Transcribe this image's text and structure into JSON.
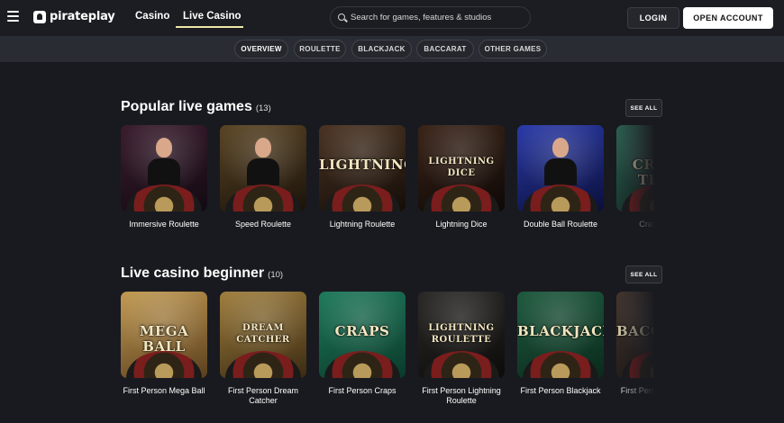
{
  "header": {
    "logo_text": "pirateplay",
    "nav": [
      {
        "label": "Casino"
      },
      {
        "label": "Live Casino",
        "active": true
      }
    ],
    "search_placeholder": "Search for games, features & studios",
    "login_label": "LOGIN",
    "open_account_label": "OPEN ACCOUNT",
    "accent_color": "#ede7a8"
  },
  "subnav": {
    "items": [
      {
        "label": "OVERVIEW",
        "active": true
      },
      {
        "label": "ROULETTE"
      },
      {
        "label": "BLACKJACK"
      },
      {
        "label": "BACCARAT"
      },
      {
        "label": "OTHER GAMES"
      }
    ]
  },
  "sections": [
    {
      "title": "Popular live games",
      "count": "(13)",
      "see_all_label": "SEE ALL",
      "games": [
        {
          "title": "Immersive Roulette",
          "art_text": "",
          "colors": [
            "#3a1c2e",
            "#120a12"
          ]
        },
        {
          "title": "Speed Roulette",
          "art_text": "",
          "colors": [
            "#5a4524",
            "#1a120a"
          ]
        },
        {
          "title": "Lightning Roulette",
          "art_text": "LIGHTNING",
          "colors": [
            "#4a3322",
            "#140d08"
          ]
        },
        {
          "title": "Lightning Dice",
          "art_text": "LIGHTNING DICE",
          "colors": [
            "#3a2418",
            "#0e0806"
          ]
        },
        {
          "title": "Double Ball Roulette",
          "art_text": "",
          "colors": [
            "#2a3aa8",
            "#0a0f3a"
          ]
        },
        {
          "title": "Crazy Time",
          "art_text": "CRAZY TIME",
          "colors": [
            "#2e6a58",
            "#0f2a22"
          ]
        }
      ]
    },
    {
      "title": "Live casino beginner",
      "count": "(10)",
      "see_all_label": "SEE ALL",
      "games": [
        {
          "title": "First Person Mega Ball",
          "art_text": "MEGA BALL",
          "colors": [
            "#c29a52",
            "#5a3f1e"
          ]
        },
        {
          "title": "First Person Dream Catcher",
          "art_text": "DREAM CATCHER",
          "colors": [
            "#a07f3e",
            "#3a2a12"
          ]
        },
        {
          "title": "First Person Craps",
          "art_text": "CRAPS",
          "colors": [
            "#1f7a5c",
            "#0a3a2a"
          ]
        },
        {
          "title": "First Person Lightning Roulette",
          "art_text": "LIGHTNING ROULETTE",
          "colors": [
            "#2b2a28",
            "#0c0b0a"
          ]
        },
        {
          "title": "First Person Blackjack",
          "art_text": "BLACKJACK",
          "colors": [
            "#1e5a3e",
            "#0a2a1c"
          ]
        },
        {
          "title": "First Person Baccarat",
          "art_text": "BACCARAT",
          "colors": [
            "#4a3a30",
            "#1a1410"
          ]
        }
      ]
    }
  ]
}
